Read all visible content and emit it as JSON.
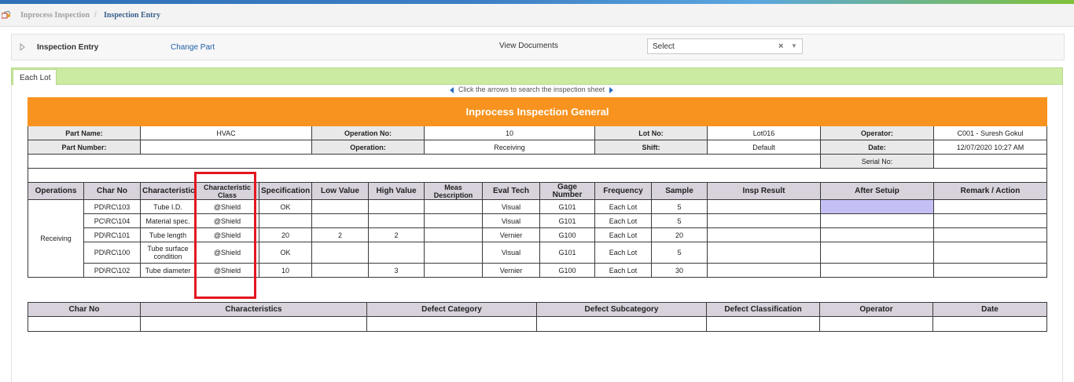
{
  "breadcrumb": {
    "root": "Inprocess Inspection",
    "separator": "/",
    "current": "Inspection Entry"
  },
  "toolbar": {
    "title": "Inspection Entry",
    "change_part": "Change Part",
    "view_documents_label": "View Documents",
    "select_value": "Select",
    "clear_glyph": "×",
    "dropdown_glyph": "▼"
  },
  "tabs": [
    {
      "label": "Each Lot",
      "active": true
    }
  ],
  "hint": "Click the arrows to search the inspection sheet",
  "general": {
    "title": "Inprocess Inspection General",
    "part_name_label": "Part Name:",
    "part_name": "HVAC",
    "operation_no_label": "Operation No:",
    "operation_no": "10",
    "lot_no_label": "Lot No:",
    "lot_no": "Lot016",
    "operator_label": "Operator:",
    "operator": "C001 - Suresh Gokul",
    "part_number_label": "Part Number:",
    "part_number": "",
    "operation_label": "Operation:",
    "operation": "Receiving",
    "shift_label": "Shift:",
    "shift": "Default",
    "date_label": "Date:",
    "date": "12/07/2020 10:27 AM",
    "serial_no_label": "Serial No:",
    "serial_no": ""
  },
  "columns": [
    "Operations",
    "Char No",
    "Characteristics",
    "Characteristic Class",
    "Specification",
    "Low Value",
    "High Value",
    "Meas Description",
    "Eval Tech",
    "Gage Number",
    "Frequency",
    "Sample",
    "Insp Result",
    "After Setuip",
    "Remark / Action"
  ],
  "operation_group": "Receiving",
  "rows": [
    {
      "char_no": "PD\\RC\\103",
      "characteristic": "Tube I.D.",
      "class": "@Shield",
      "spec": "OK",
      "low": "",
      "high": "",
      "meas": "",
      "eval": "Visual",
      "gage": "G101",
      "freq": "Each Lot",
      "sample": "5"
    },
    {
      "char_no": "PC\\RC\\104",
      "characteristic": "Material spec.",
      "class": "@Shield",
      "spec": "",
      "low": "",
      "high": "",
      "meas": "",
      "eval": "Visual",
      "gage": "G101",
      "freq": "Each Lot",
      "sample": "5"
    },
    {
      "char_no": "PD\\RC\\101",
      "characteristic": "Tube length",
      "class": "@Shield",
      "spec": "20",
      "low": "2",
      "high": "2",
      "meas": "",
      "eval": "Vernier",
      "gage": "G100",
      "freq": "Each Lot",
      "sample": "20"
    },
    {
      "char_no": "PD\\RC\\100",
      "characteristic": "Tube surface condition",
      "class": "@Shield",
      "spec": "OK",
      "low": "",
      "high": "",
      "meas": "",
      "eval": "Visual",
      "gage": "G101",
      "freq": "Each Lot",
      "sample": "5"
    },
    {
      "char_no": "PD\\RC\\102",
      "characteristic": "Tube diameter",
      "class": "@Shield",
      "spec": "10",
      "low": "",
      "high": "3",
      "meas": "",
      "eval": "Vernier",
      "gage": "G100",
      "freq": "Each Lot",
      "sample": "30"
    }
  ],
  "defect_columns": [
    "Char No",
    "Characteristics",
    "Defect Category",
    "Defect Subcategory",
    "Defect Classification",
    "Operator",
    "Date"
  ],
  "colors": {
    "banner": "#f7931e",
    "tab_strip": "#cbeaa2",
    "highlight": "#e3161f",
    "after_setup_cell": "#c4c0f5"
  }
}
